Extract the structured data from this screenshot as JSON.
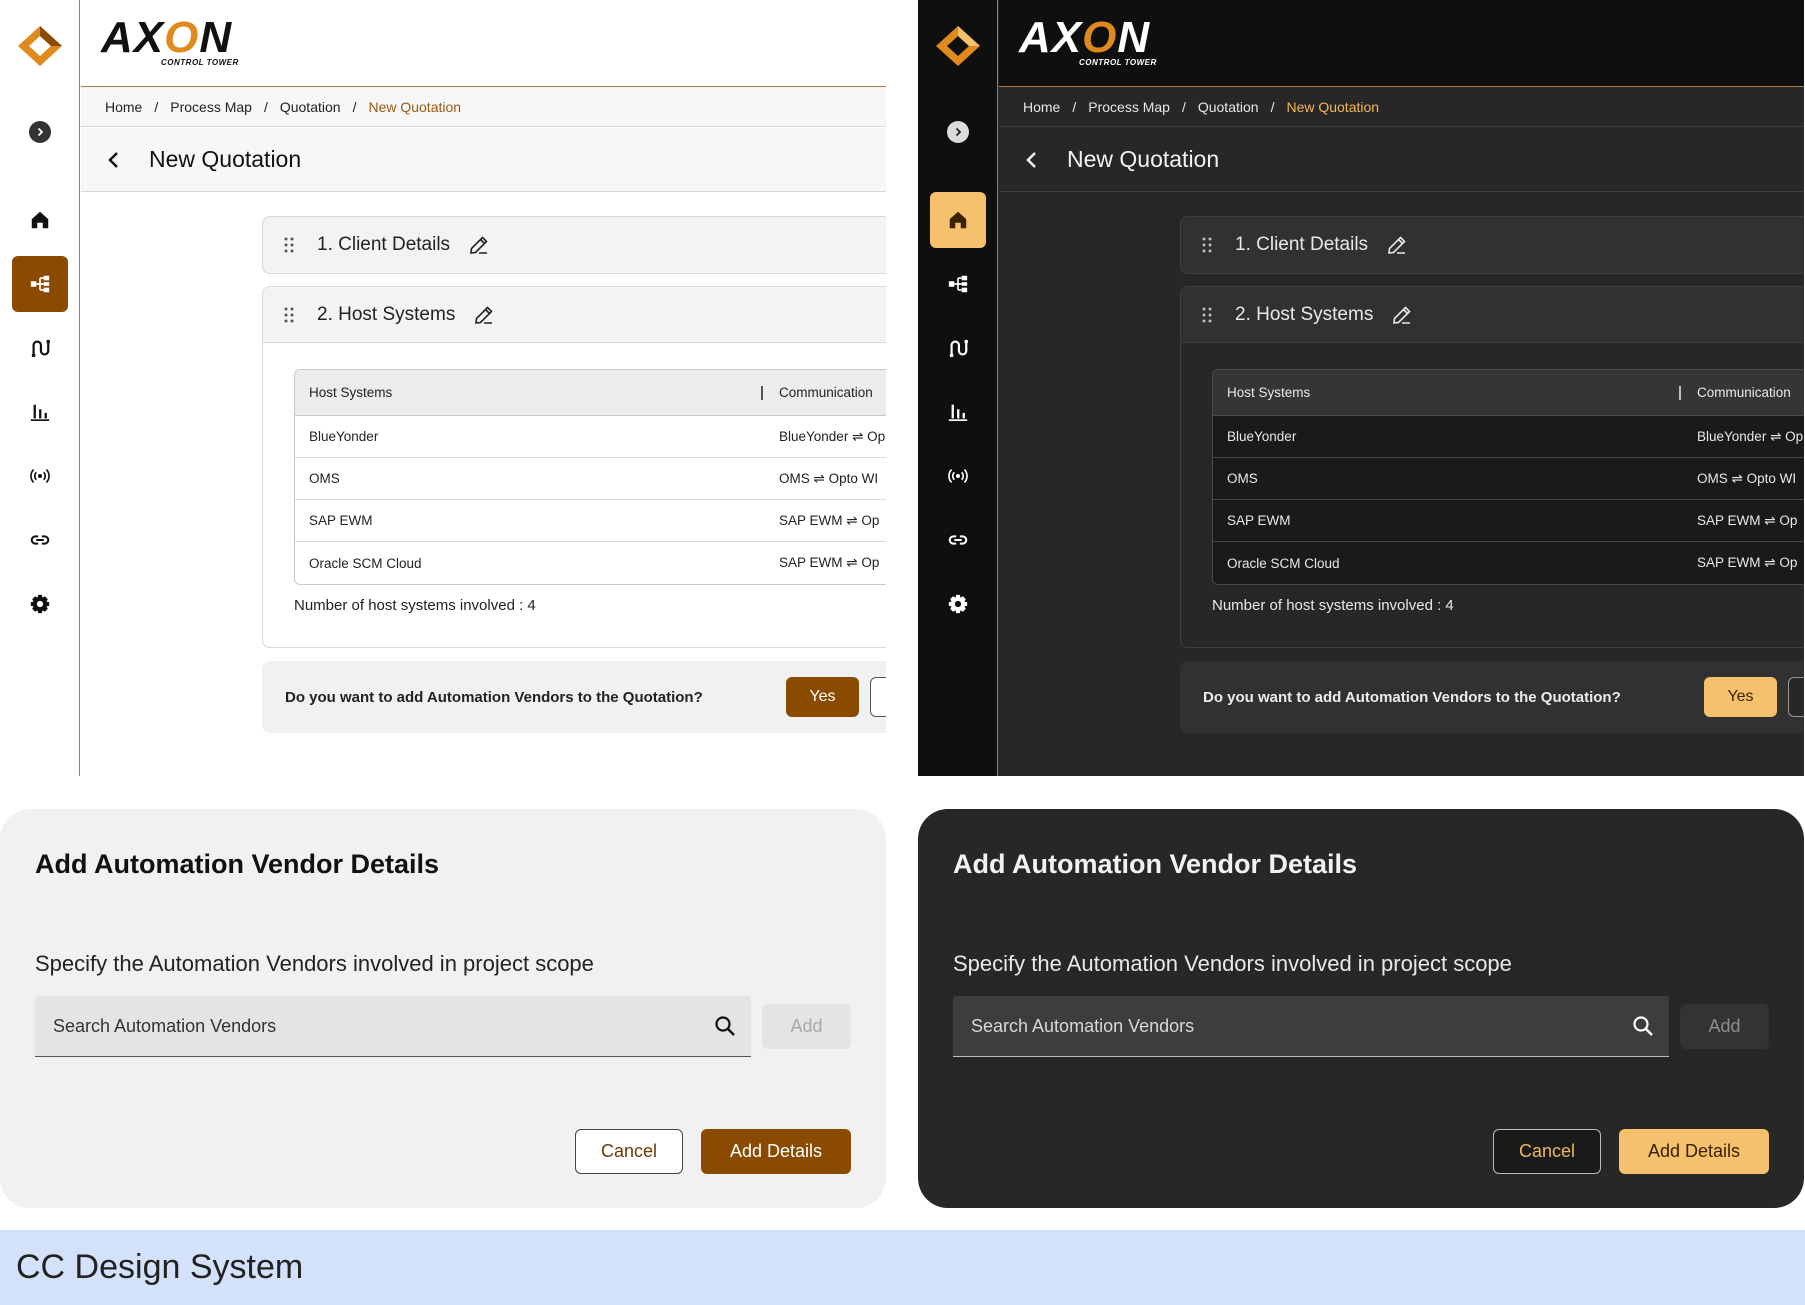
{
  "brand": {
    "name_prefix": "AX",
    "name_accent": "O",
    "name_suffix": "N",
    "tagline": "CONTROL TOWER"
  },
  "colors": {
    "light_accent": "#8a4b00",
    "dark_accent": "#f5c16c",
    "divider": "#b5783f",
    "footer_bg": "#d4e1fb"
  },
  "sidebar": {
    "collapse_icon": "chevron-right-icon",
    "items": [
      {
        "icon": "home-icon"
      },
      {
        "icon": "process-map-icon"
      },
      {
        "icon": "route-icon"
      },
      {
        "icon": "bar-chart-icon"
      },
      {
        "icon": "broadcast-icon"
      },
      {
        "icon": "link-icon"
      },
      {
        "icon": "gear-icon"
      }
    ],
    "active_light": "process-map",
    "active_dark": "home"
  },
  "breadcrumb": {
    "items": [
      "Home",
      "Process Map",
      "Quotation"
    ],
    "separator": "/",
    "current": "New Quotation"
  },
  "page": {
    "title": "New Quotation"
  },
  "sections": {
    "client_details": "1. Client Details",
    "host_systems": "2. Host Systems"
  },
  "host_table": {
    "headers": [
      "Host Systems",
      "Communication"
    ],
    "rows": [
      {
        "host": "BlueYonder",
        "communication": "BlueYonder ⇌ Op"
      },
      {
        "host": "OMS",
        "communication": "OMS ⇌ Opto WI"
      },
      {
        "host": "SAP EWM",
        "communication": "SAP EWM ⇌ Op"
      },
      {
        "host": "Oracle SCM Cloud",
        "communication": "SAP EWM ⇌ Op"
      }
    ],
    "count_label": "Number of host systems involved : 4"
  },
  "question": {
    "text": "Do you want to add Automation Vendors to the Quotation?",
    "yes_label": "Yes"
  },
  "modal": {
    "title": "Add Automation Vendor Details",
    "subtitle": "Specify the Automation Vendors involved in project scope",
    "search_placeholder": "Search Automation Vendors",
    "add_label": "Add",
    "cancel_label": "Cancel",
    "submit_label": "Add Details"
  },
  "footer": {
    "title": "CC Design System"
  }
}
